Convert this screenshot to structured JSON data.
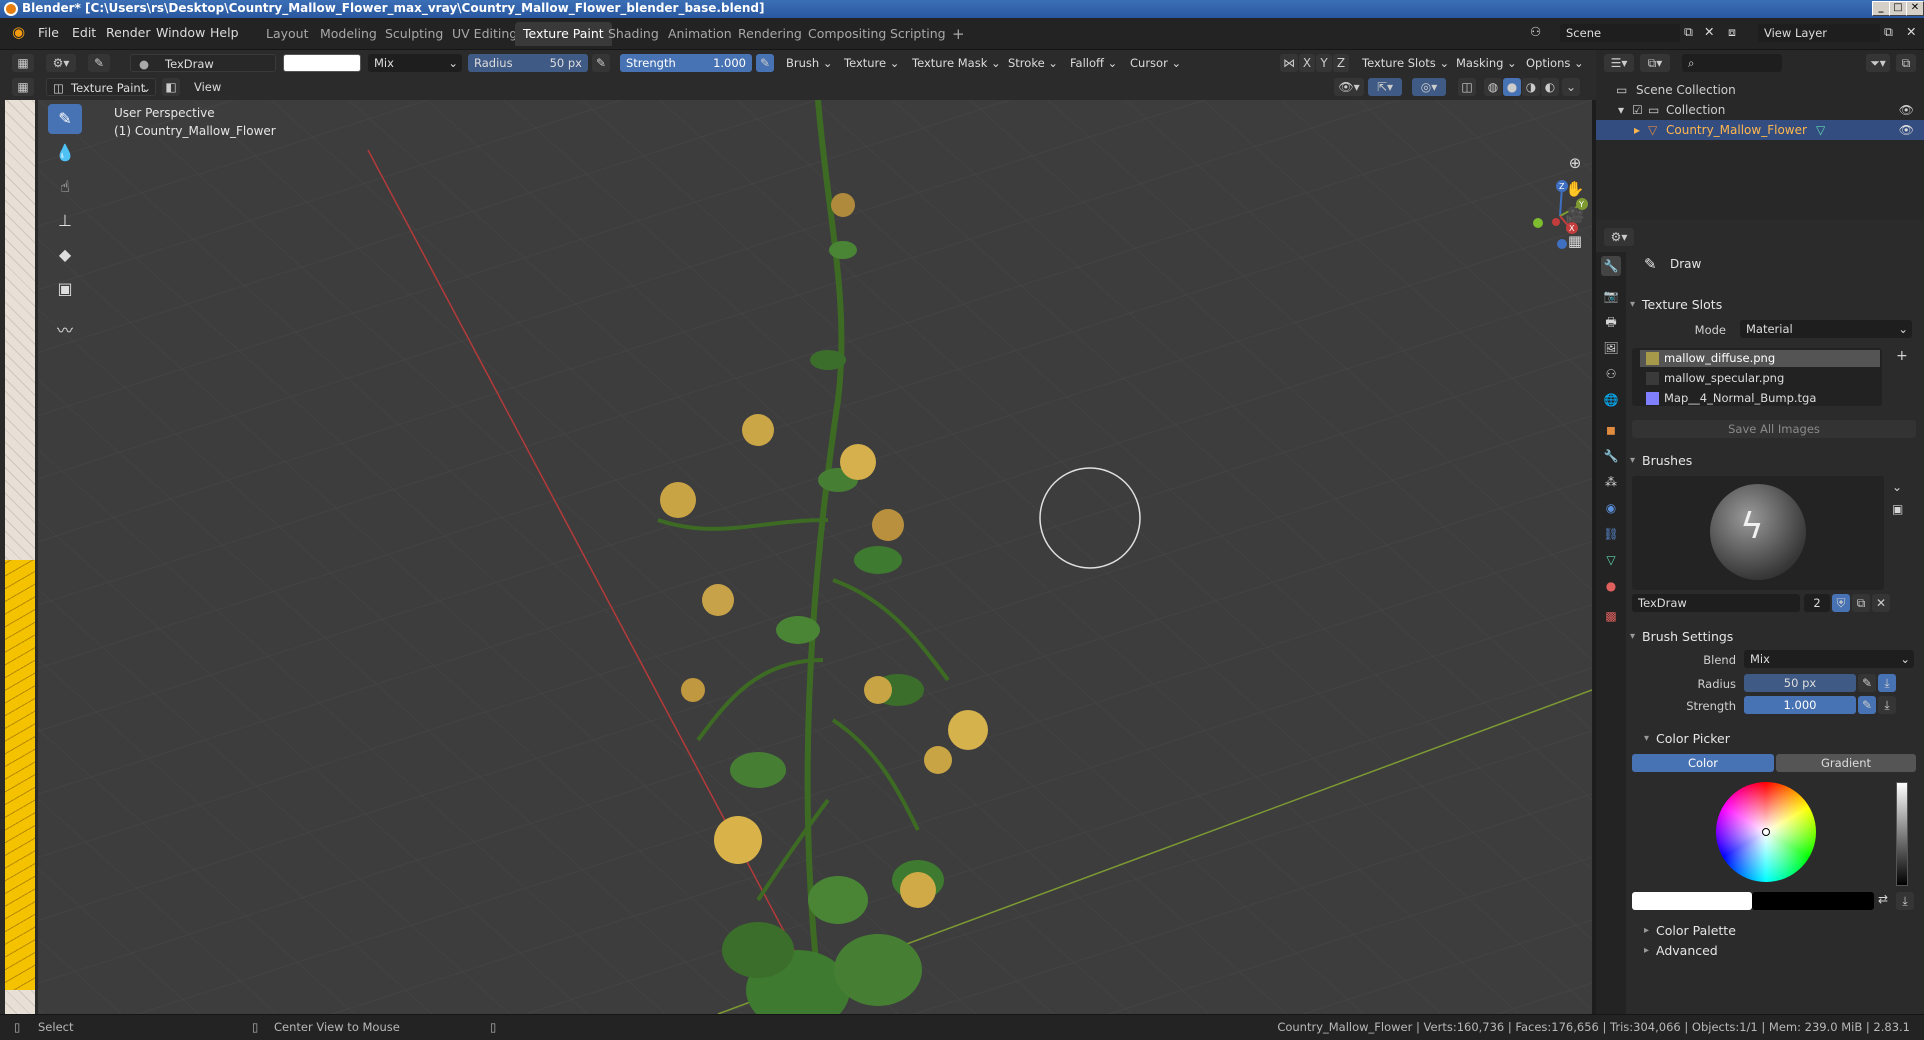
{
  "window": {
    "title": "Blender* [C:\\Users\\rs\\Desktop\\Country_Mallow_Flower_max_vray\\Country_Mallow_Flower_blender_base.blend]"
  },
  "menu": [
    "File",
    "Edit",
    "Render",
    "Window",
    "Help"
  ],
  "workspaces": [
    "Layout",
    "Modeling",
    "Sculpting",
    "UV Editing",
    "Texture Paint",
    "Shading",
    "Animation",
    "Rendering",
    "Compositing",
    "Scripting"
  ],
  "active_workspace": "Texture Paint",
  "scene": {
    "name": "Scene",
    "view_layer": "View Layer"
  },
  "header": {
    "brush_name": "TexDraw",
    "blend": "Mix",
    "radius_label": "Radius",
    "radius_value": "50 px",
    "strength_label": "Strength",
    "strength_value": "1.000",
    "menus": [
      "Brush",
      "Texture",
      "Texture Mask",
      "Stroke",
      "Falloff",
      "Cursor"
    ],
    "right_menus": [
      "Texture Slots",
      "Masking",
      "Options"
    ],
    "axes": [
      "X",
      "Y",
      "Z"
    ],
    "mode": "Texture Paint",
    "view_menu": "View",
    "paint_color": "#ffffff"
  },
  "viewport": {
    "perspective": "User Perspective",
    "object": "(1) Country_Mallow_Flower",
    "background": "#3d3d3d",
    "x_axis_color": "#b53a3a",
    "y_axis_color": "#7d9a33"
  },
  "outliner": {
    "root": "Scene Collection",
    "collection": "Collection",
    "object": "Country_Mallow_Flower"
  },
  "properties": {
    "tool_name": "Draw",
    "texture_slots": {
      "title": "Texture Slots",
      "mode_label": "Mode",
      "mode_value": "Material",
      "slots": [
        {
          "name": "mallow_diffuse.png",
          "color": "#a69a4a"
        },
        {
          "name": "mallow_specular.png",
          "color": "#3a3a3a"
        },
        {
          "name": "Map__4_Normal_Bump.tga",
          "color": "#8080ff"
        }
      ],
      "save_button": "Save All Images"
    },
    "brushes": {
      "title": "Brushes",
      "brush_name": "TexDraw",
      "users": "2"
    },
    "brush_settings": {
      "title": "Brush Settings",
      "blend_label": "Blend",
      "blend_value": "Mix",
      "radius_label": "Radius",
      "radius_value": "50 px",
      "strength_label": "Strength",
      "strength_value": "1.000"
    },
    "color_picker": {
      "title": "Color Picker",
      "tabs": [
        "Color",
        "Gradient"
      ],
      "active_tab": "Color",
      "primary": "#ffffff",
      "secondary": "#000000"
    },
    "color_palette": "Color Palette",
    "advanced": "Advanced"
  },
  "status": {
    "left": "Select",
    "middle": "Center View to Mouse",
    "right": "Country_Mallow_Flower | Verts:160,736 | Faces:176,656 | Tris:304,066 | Objects:1/1 | Mem: 239.0 MiB | 2.83.1"
  }
}
